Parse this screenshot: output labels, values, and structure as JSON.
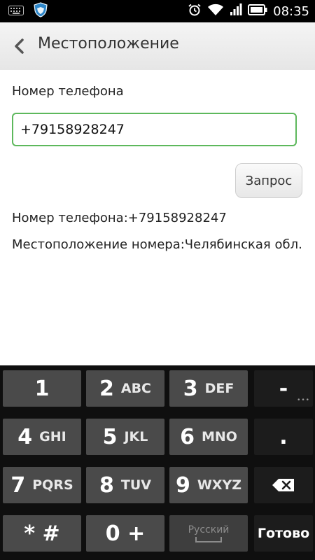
{
  "status_bar": {
    "time": "08:35",
    "left_icons": [
      "keyboard-icon",
      "shield-app-icon"
    ],
    "right_icons": [
      "alarm-clock-icon",
      "wifi-icon",
      "signal-icon",
      "battery-icon"
    ]
  },
  "action_bar": {
    "title": "Местоположение"
  },
  "form": {
    "phone_label": "Номер телефона",
    "phone_value": "+79158928247",
    "query_button": "Запрос"
  },
  "result": {
    "phone_line": "Номер телефона:+79158928247",
    "location_line": "Местоположение номера:Челябинская обл."
  },
  "keyboard": {
    "rows": [
      [
        {
          "main": "1",
          "sub": ""
        },
        {
          "main": "2",
          "sub": "ABC"
        },
        {
          "main": "3",
          "sub": "DEF"
        },
        {
          "main": "-",
          "sub": ""
        }
      ],
      [
        {
          "main": "4",
          "sub": "GHI"
        },
        {
          "main": "5",
          "sub": "JKL"
        },
        {
          "main": "6",
          "sub": "MNO"
        },
        {
          "main": ".",
          "sub": ""
        }
      ],
      [
        {
          "main": "7",
          "sub": "PQRS"
        },
        {
          "main": "8",
          "sub": "TUV"
        },
        {
          "main": "9",
          "sub": "WXYZ"
        },
        {
          "main": "",
          "sub": ""
        }
      ],
      [
        {
          "main": "* #",
          "sub": ""
        },
        {
          "main": "0 +",
          "sub": ""
        },
        {
          "main": "Русский",
          "sub": ""
        },
        {
          "main": "Готово",
          "sub": ""
        }
      ]
    ]
  },
  "colors": {
    "input_border": "#5db85c",
    "keyboard_bg": "#0f0f0f",
    "key_bg": "#4a4a4a"
  }
}
